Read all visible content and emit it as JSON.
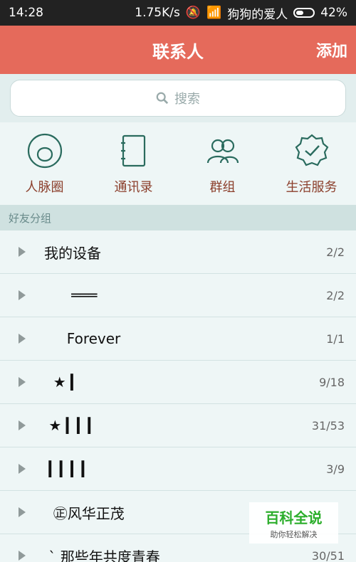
{
  "status_bar": {
    "time": "14:28",
    "speed": "1.75K/s",
    "network_name": "狗狗的爱人",
    "battery": "42%"
  },
  "header": {
    "title": "联系人",
    "add_label": "添加"
  },
  "search": {
    "placeholder": "搜索"
  },
  "shortcuts": [
    {
      "label": "人脉圈",
      "icon": "person-circle-icon"
    },
    {
      "label": "通讯录",
      "icon": "address-book-icon"
    },
    {
      "label": "群组",
      "icon": "group-icon"
    },
    {
      "label": "生活服务",
      "icon": "badge-check-icon"
    }
  ],
  "group_header": "好友分组",
  "groups": [
    {
      "name": "我的设备",
      "count": "2/2"
    },
    {
      "name": "      ═══",
      "count": "2/2"
    },
    {
      "name": "     Forever",
      "count": "1/1"
    },
    {
      "name": "  ★ ▎",
      "count": "9/18"
    },
    {
      "name": " ★ ▎▎▎",
      "count": "31/53"
    },
    {
      "name": " ▎▎▎▎",
      "count": "3/9"
    },
    {
      "name": "  ㊣风华正茂",
      "count": ""
    },
    {
      "name": " ˋ 那些年共度青春",
      "count": "30/51"
    }
  ],
  "watermark": {
    "title": "百科全说",
    "subtitle": "助你轻松解决"
  },
  "colors": {
    "header_bg": "#e56a5b",
    "shortcut_icon": "#2a6b5e",
    "shortcut_label": "#8b3e2b"
  }
}
